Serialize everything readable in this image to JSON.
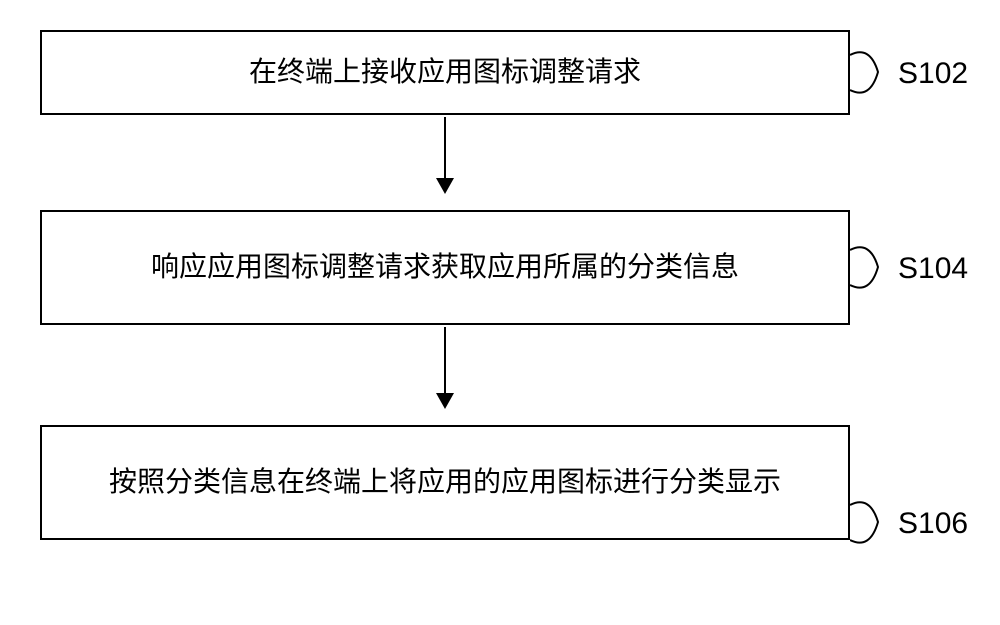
{
  "steps": [
    {
      "text": "在终端上接收应用图标调整请求",
      "label": "S102"
    },
    {
      "text": "响应应用图标调整请求获取应用所属的分类信息",
      "label": "S104"
    },
    {
      "text": "按照分类信息在终端上将应用的应用图标进行分类显示",
      "label": "S106"
    }
  ]
}
